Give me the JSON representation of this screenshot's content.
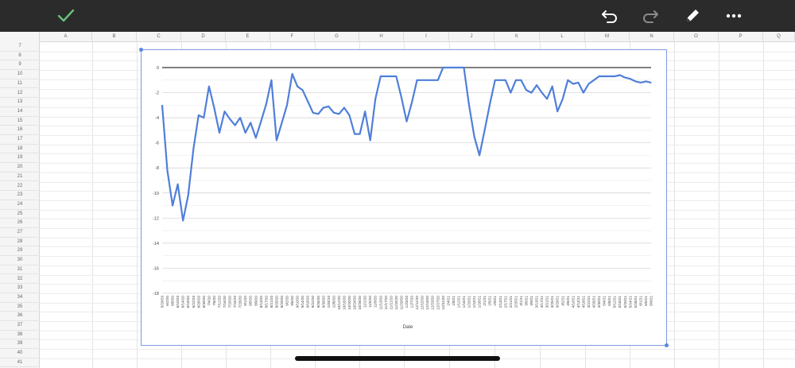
{
  "toolbar": {
    "background": "#2b2b2c",
    "icons": [
      "checkmark-icon",
      "undo-icon",
      "redo-icon",
      "pencil-icon",
      "more-icon"
    ],
    "accent": "#6ac174"
  },
  "sheet": {
    "columns": [
      "A",
      "B",
      "C",
      "D",
      "E",
      "F",
      "G",
      "H",
      "I",
      "J",
      "K",
      "L",
      "M",
      "N",
      "O",
      "P",
      "Q"
    ],
    "rows": [
      "7",
      "8",
      "9",
      "10",
      "11",
      "12",
      "13",
      "14",
      "15",
      "16",
      "17",
      "18",
      "19",
      "20",
      "21",
      "22",
      "23",
      "24",
      "25",
      "26",
      "27",
      "28",
      "29",
      "30",
      "31",
      "32",
      "33",
      "34",
      "35",
      "36",
      "37",
      "38",
      "39",
      "40",
      "41"
    ]
  },
  "chart_data": {
    "type": "line",
    "xlabel": "Date",
    "ylabel": "",
    "title": "",
    "ylim": [
      -18,
      0
    ],
    "yticks": [
      0,
      -2,
      -4,
      -6,
      -8,
      -10,
      -12,
      -14,
      -16,
      -18
    ],
    "x_tick_labels": [
      "5/29/20",
      "6/2/20",
      "6/6/20",
      "6/10/20",
      "6/14/20",
      "6/18/20",
      "6/22/20",
      "6/26/20",
      "6/30/20",
      "7/4/20",
      "7/8/20",
      "7/12/20",
      "7/16/20",
      "7/20/20",
      "7/24/20",
      "7/28/20",
      "8/1/20",
      "8/5/20",
      "8/9/20",
      "8/13/20",
      "8/17/20",
      "8/21/20",
      "8/25/20",
      "8/29/20",
      "9/2/20",
      "9/6/20",
      "9/10/20",
      "9/14/20",
      "9/18/20",
      "9/22/20",
      "9/26/20",
      "9/30/20",
      "10/4/20",
      "10/8/20",
      "10/12/20",
      "10/16/20",
      "10/20/20",
      "10/24/20",
      "10/28/20",
      "11/1/20",
      "11/5/20",
      "11/9/20",
      "11/13/20",
      "11/17/20",
      "11/21/20",
      "11/25/20",
      "11/29/20",
      "12/3/20",
      "12/7/20",
      "12/11/20",
      "12/15/20",
      "12/19/20",
      "12/23/20",
      "12/27/20",
      "12/31/20",
      "1/4/21",
      "1/8/21",
      "1/12/21",
      "1/16/21",
      "1/20/21",
      "1/24/21",
      "1/28/21",
      "2/1/21",
      "2/5/21",
      "2/9/21",
      "2/13/21",
      "2/17/21",
      "2/21/21",
      "2/25/21",
      "3/1/21",
      "3/5/21",
      "3/9/21",
      "3/13/21",
      "3/17/21",
      "3/21/21",
      "3/25/21",
      "3/29/21",
      "4/2/21",
      "4/6/21",
      "4/10/21",
      "4/14/21",
      "4/18/21",
      "4/22/21",
      "4/26/21",
      "4/30/21",
      "5/4/21",
      "5/8/21",
      "5/12/21",
      "5/16/21",
      "5/20/21",
      "5/24/21",
      "5/28/21",
      "6/1/21",
      "6/5/21",
      "6/9/21"
    ],
    "series": [
      {
        "color": "#4f7fd9",
        "x": [
          0,
          1,
          2,
          3,
          4,
          5,
          6,
          7,
          8,
          9,
          10,
          11,
          12,
          13,
          14,
          15,
          16,
          17,
          18,
          19,
          20,
          21,
          22,
          23,
          24,
          25,
          26,
          27,
          28,
          29,
          30,
          31,
          32,
          33,
          34,
          35,
          36,
          37,
          38,
          39,
          40,
          41,
          42,
          43,
          44,
          45,
          46,
          47,
          48,
          49,
          50,
          51,
          52,
          53,
          54,
          55,
          56,
          57,
          58,
          59,
          60,
          61,
          62,
          63,
          64,
          65,
          66,
          67,
          68,
          69,
          70,
          71,
          72,
          73,
          74,
          75,
          76,
          77,
          78,
          79,
          80,
          81,
          82,
          83,
          84,
          85,
          86,
          87,
          88,
          89,
          90,
          91,
          92,
          93,
          94
        ],
        "values": [
          -3.0,
          -8.2,
          -11.0,
          -9.3,
          -12.2,
          -10.2,
          -6.5,
          -3.8,
          -4.0,
          -1.5,
          -3.2,
          -5.2,
          -3.5,
          -4.1,
          -4.6,
          -4.0,
          -5.2,
          -4.4,
          -5.6,
          -4.3,
          -2.9,
          -1.0,
          -5.8,
          -4.4,
          -3.0,
          -0.5,
          -1.5,
          -1.8,
          -2.7,
          -3.6,
          -3.7,
          -3.2,
          -3.1,
          -3.6,
          -3.7,
          -3.2,
          -3.8,
          -5.3,
          -5.3,
          -3.5,
          -5.8,
          -2.5,
          -0.7,
          -0.7,
          -0.7,
          -0.7,
          -2.4,
          -4.3,
          -2.8,
          -1.0,
          -1.0,
          -1.0,
          -1.0,
          -1.0,
          0.0,
          0.0,
          0.0,
          0.0,
          0.0,
          -3.0,
          -5.5,
          -7.0,
          -5.0,
          -2.9,
          -1.0,
          -1.0,
          -1.0,
          -2.0,
          -1.0,
          -1.0,
          -1.8,
          -2.0,
          -1.4,
          -2.0,
          -2.5,
          -1.5,
          -3.5,
          -2.5,
          -1.0,
          -1.3,
          -1.2,
          -2.0,
          -1.3,
          -1.0,
          -0.7,
          -0.7,
          -0.7,
          -0.7,
          -0.6,
          -0.8,
          -0.9,
          -1.1,
          -1.2,
          -1.1,
          -1.2
        ]
      }
    ],
    "line_color": "#4f7fd9",
    "zero_line_color": "#333333",
    "grid": true,
    "legend": "none"
  }
}
